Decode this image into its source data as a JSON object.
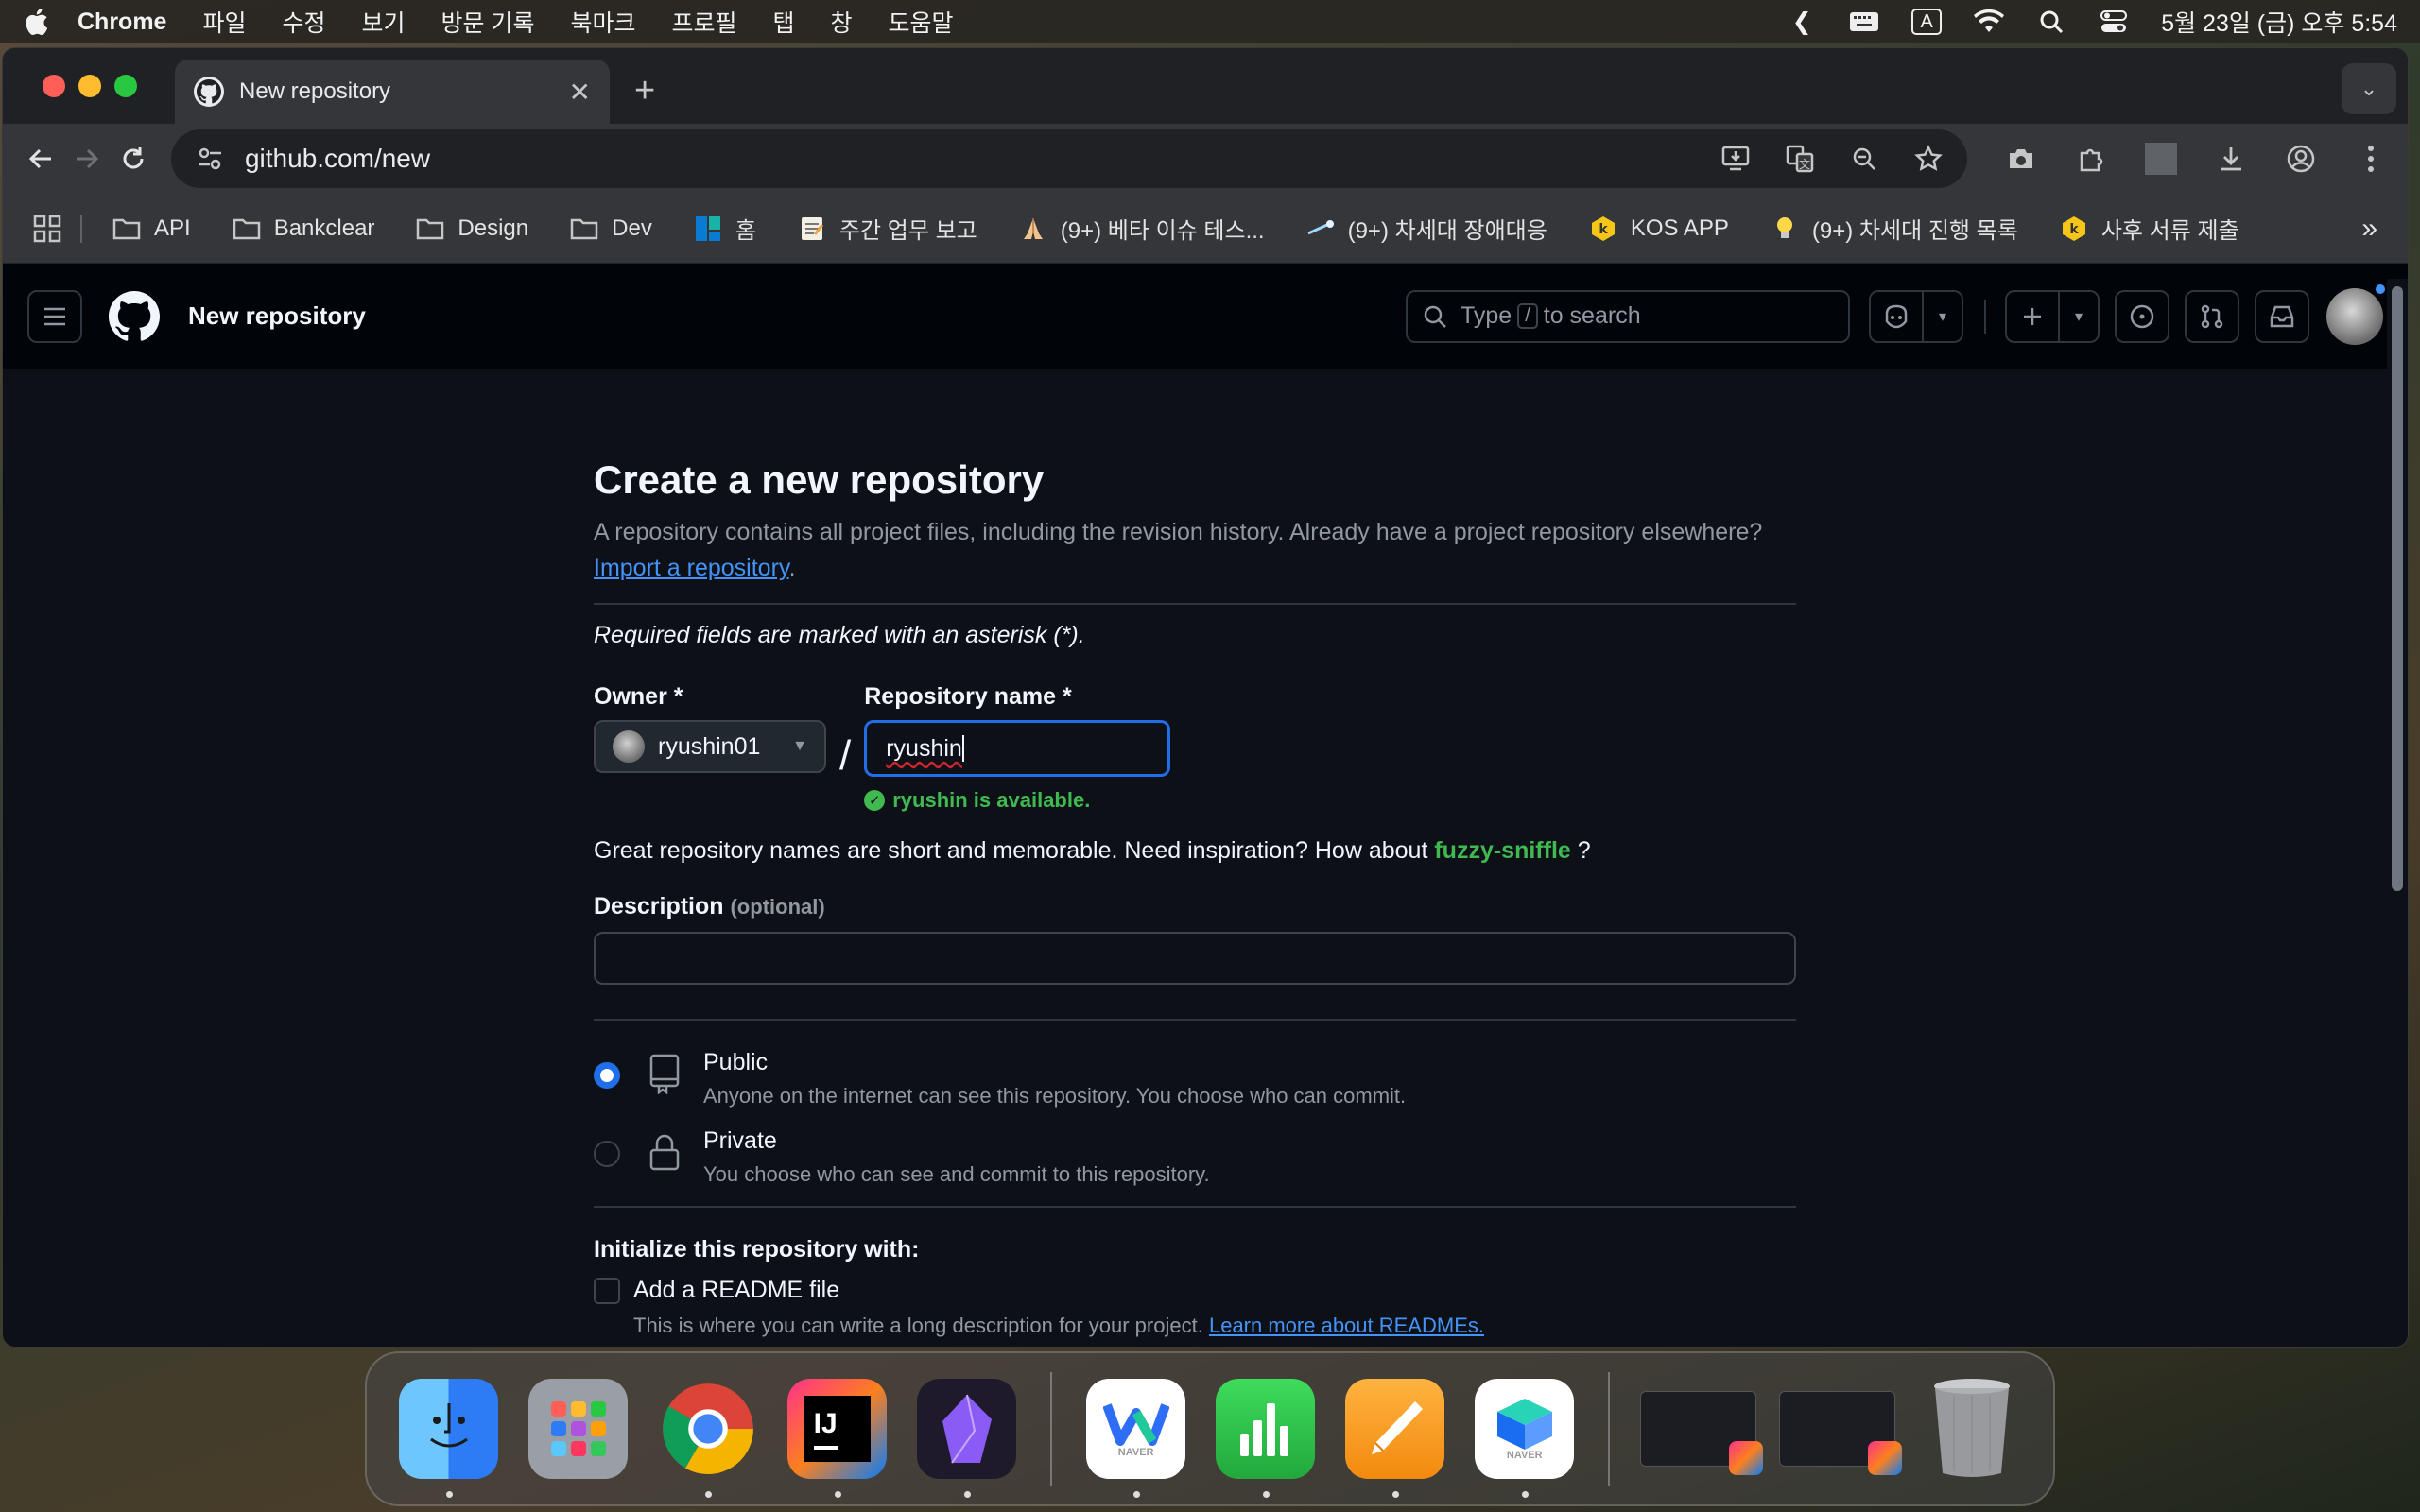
{
  "menubar": {
    "app": "Chrome",
    "items": [
      "파일",
      "수정",
      "보기",
      "방문 기록",
      "북마크",
      "프로필",
      "탭",
      "창",
      "도움말"
    ],
    "input_indicator": "A",
    "datetime": "5월 23일 (금) 오후 5:54"
  },
  "browser": {
    "tab_title": "New repository",
    "url": "github.com/new",
    "bookmarks": [
      {
        "label": "API",
        "icon": "folder-icon"
      },
      {
        "label": "Bankclear",
        "icon": "folder-icon"
      },
      {
        "label": "Design",
        "icon": "folder-icon"
      },
      {
        "label": "Dev",
        "icon": "folder-icon"
      },
      {
        "label": "홈",
        "icon": "board-icon"
      },
      {
        "label": "주간 업무 보고",
        "icon": "note-icon"
      },
      {
        "label": "(9+) 베타 이슈 테스...",
        "icon": "pray-icon"
      },
      {
        "label": "(9+) 차세대 장애대응",
        "icon": "comet-icon"
      },
      {
        "label": "KOS APP",
        "icon": "k-icon"
      },
      {
        "label": "(9+) 차세대 진행 목록",
        "icon": "bulb-icon"
      },
      {
        "label": "사후 서류 제출",
        "icon": "k-icon"
      }
    ],
    "more": "»"
  },
  "github": {
    "header_title": "New repository",
    "search_placeholder_pre": "Type",
    "search_key": "/",
    "search_placeholder_post": "to search"
  },
  "page": {
    "title": "Create a new repository",
    "intro": "A repository contains all project files, including the revision history. Already have a project repository elsewhere?",
    "import_link": "Import a repository",
    "required_note": "Required fields are marked with an asterisk (*).",
    "owner_label": "Owner *",
    "owner_value": "ryushin01",
    "separator": "/",
    "repo_label": "Repository name *",
    "repo_value": "ryushin",
    "available_msg": "ryushin is available.",
    "inspiration_text": "Great repository names are short and memorable. Need inspiration? How about",
    "suggestion": "fuzzy-sniffle",
    "inspiration_end": "?",
    "description_label": "Description",
    "description_optional": "(optional)",
    "description_value": "",
    "visibility": [
      {
        "title": "Public",
        "sub": "Anyone on the internet can see this repository. You choose who can commit.",
        "selected": true
      },
      {
        "title": "Private",
        "sub": "You choose who can see and commit to this repository.",
        "selected": false
      }
    ],
    "init_title": "Initialize this repository with:",
    "readme_label": "Add a README file",
    "readme_sub": "This is where you can write a long description for your project.",
    "readme_link": "Learn more about READMEs."
  },
  "dock": {
    "apps": [
      {
        "name": "finder",
        "color": "#3a8ef6",
        "running": true
      },
      {
        "name": "launchpad",
        "color": "#9aa0a6",
        "running": false
      },
      {
        "name": "chrome",
        "color": "#ffffff",
        "running": true
      },
      {
        "name": "intellij",
        "color": "#e8407a",
        "running": true
      },
      {
        "name": "obsidian",
        "color": "#2b2540",
        "running": true
      },
      {
        "name": "naver-works",
        "color": "#ffffff",
        "running": true
      },
      {
        "name": "numbers",
        "color": "#2fbf4a",
        "running": true
      },
      {
        "name": "pages",
        "color": "#f59a1c",
        "running": true
      },
      {
        "name": "naver-box",
        "color": "#ffffff",
        "running": true
      }
    ],
    "naver_caption": "NAVER",
    "ij_label": "IJ"
  }
}
